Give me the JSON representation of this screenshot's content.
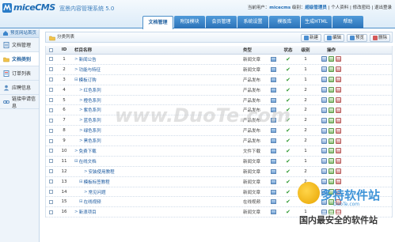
{
  "header": {
    "logo": "miceCMS",
    "subtitle": "宽景内容管理系统 5.0",
    "user_prefix": "当前用户：",
    "user_name": "micecms",
    "level_prefix": "级别：",
    "level_name": "超级管理员",
    "links": "| 个人资料 | 修改密码 | 退出登录"
  },
  "tabs": [
    {
      "label": "文档管理",
      "active": true
    },
    {
      "label": "附加模块",
      "active": false
    },
    {
      "label": "会员管理",
      "active": false
    },
    {
      "label": "系统设置",
      "active": false
    },
    {
      "label": "模板库",
      "active": false
    },
    {
      "label": "生成HTML",
      "active": false
    },
    {
      "label": "帮助",
      "active": false
    }
  ],
  "sidebar": {
    "top_label": "预览网站首页",
    "items": [
      {
        "label": "文档管理",
        "active": false
      },
      {
        "label": "文档类别",
        "active": true
      },
      {
        "label": "订单列表",
        "active": false
      },
      {
        "label": "应聘信息",
        "active": false
      },
      {
        "label": "链接申请信息",
        "active": false
      }
    ]
  },
  "toolbar": {
    "title": "分类列表",
    "buttons": [
      "新建",
      "编辑",
      "预览",
      "删除"
    ]
  },
  "table": {
    "headers": {
      "id": "ID",
      "name": "栏目名称",
      "type": "类型",
      "status": "状态",
      "level": "级别",
      "ops": "操作"
    },
    "rows": [
      {
        "id": "1",
        "name": "新闻公告",
        "prefix": ">",
        "indent": 0,
        "type": "新闻文章",
        "status": "✔",
        "level": "1"
      },
      {
        "id": "2",
        "name": "功能与特征",
        "prefix": ">",
        "indent": 0,
        "type": "新闻文章",
        "status": "✔",
        "level": "1"
      },
      {
        "id": "3",
        "name": "模板订购",
        "prefix": "⊟",
        "indent": 0,
        "type": "产品发布",
        "status": "✔",
        "level": "1"
      },
      {
        "id": "4",
        "name": "红色系列",
        "prefix": ">",
        "indent": 1,
        "type": "产品发布",
        "status": "✔",
        "level": "2"
      },
      {
        "id": "5",
        "name": "橙色系列",
        "prefix": ">",
        "indent": 1,
        "type": "产品发布",
        "status": "✔",
        "level": "2"
      },
      {
        "id": "6",
        "name": "紫色系列",
        "prefix": ">",
        "indent": 1,
        "type": "产品发布",
        "status": "✔",
        "level": "2"
      },
      {
        "id": "7",
        "name": "蓝色系列",
        "prefix": ">",
        "indent": 1,
        "type": "产品发布",
        "status": "✔",
        "level": "2"
      },
      {
        "id": "8",
        "name": "绿色系列",
        "prefix": ">",
        "indent": 1,
        "type": "产品发布",
        "status": "✔",
        "level": "2"
      },
      {
        "id": "9",
        "name": "黑色系列",
        "prefix": ">",
        "indent": 1,
        "type": "产品发布",
        "status": "✔",
        "level": "2"
      },
      {
        "id": "10",
        "name": "免费下载",
        "prefix": ">",
        "indent": 0,
        "type": "文件下载",
        "status": "✔",
        "level": "1"
      },
      {
        "id": "11",
        "name": "在线文档",
        "prefix": "⊟",
        "indent": 0,
        "type": "新闻文章",
        "status": "✔",
        "level": "1"
      },
      {
        "id": "12",
        "name": "安装使用教程",
        "prefix": ">",
        "indent": 2,
        "type": "新闻文章",
        "status": "✔",
        "level": "2"
      },
      {
        "id": "13",
        "name": "模板标签教程",
        "prefix": "⊟",
        "indent": 1,
        "type": "新闻文章",
        "status": "✔",
        "level": "2"
      },
      {
        "id": "14",
        "name": "常见问题",
        "prefix": ">",
        "indent": 2,
        "type": "新闻文章",
        "status": "✔",
        "level": "2"
      },
      {
        "id": "15",
        "name": "在线视频",
        "prefix": "⊟",
        "indent": 1,
        "type": "在线视频",
        "status": "✔",
        "level": "2"
      },
      {
        "id": "16",
        "name": "新浪项目",
        "prefix": ">",
        "indent": 0,
        "type": "新闻文章",
        "status": "✔",
        "level": "1"
      }
    ]
  },
  "watermarks": {
    "site": "www.DuoTe.com",
    "brand": "多特软件站",
    "brand_sub": "DuoTe.com",
    "slogan": "国内最安全的软件站"
  },
  "colors": {
    "brand_blue": "#1f6cb4",
    "tab_blue": "#2b72b8",
    "status_green": "#2f9a32"
  }
}
